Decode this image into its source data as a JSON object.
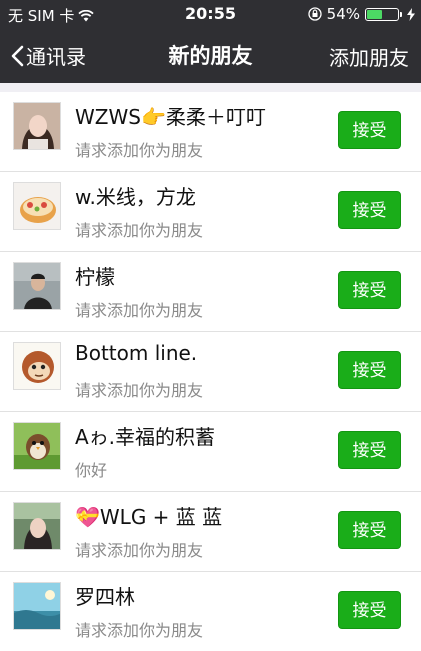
{
  "status_bar": {
    "carrier": "无 SIM 卡",
    "time": "20:55",
    "battery_percent": "54%",
    "battery_level": 0.54,
    "icons": [
      "wifi-icon",
      "orientation-lock-icon",
      "battery-icon",
      "charging-bolt-icon"
    ]
  },
  "nav": {
    "back_label": "通讯录",
    "title": "新的朋友",
    "right_action": "添加朋友"
  },
  "colors": {
    "nav_background": "#2f2f33",
    "accept_button": "#1aad19",
    "secondary_text": "#8a8a8a"
  },
  "requests": [
    {
      "name": "WZWS👉柔柔＋叮叮",
      "message": "请求添加你为朋友",
      "action": "接受"
    },
    {
      "name": "w.米线，方龙",
      "message": "请求添加你为朋友",
      "action": "接受"
    },
    {
      "name": "柠檬",
      "message": "请求添加你为朋友",
      "action": "接受"
    },
    {
      "name": "Bottom line.",
      "message": "请求添加你为朋友",
      "action": "接受"
    },
    {
      "name": "Aゎ.幸福的积蓄",
      "message": "你好",
      "action": "接受"
    },
    {
      "name": "💝WLG + 蓝 蓝",
      "message": "请求添加你为朋友",
      "action": "接受"
    },
    {
      "name": "罗四林",
      "message": "请求添加你为朋友",
      "action": "接受"
    }
  ]
}
